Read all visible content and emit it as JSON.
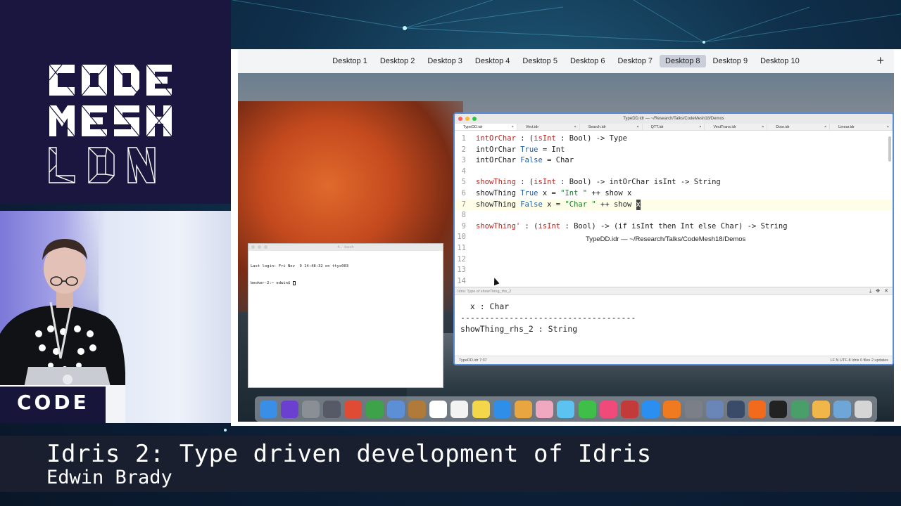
{
  "caption": {
    "title": "Idris 2: Type driven development of Idris",
    "author": "Edwin Brady"
  },
  "logo": {
    "lines": [
      "CODE",
      "MESH",
      "LDN"
    ]
  },
  "podium_sign": "CODE",
  "spaces": {
    "items": [
      "Desktop 1",
      "Desktop 2",
      "Desktop 3",
      "Desktop 4",
      "Desktop 5",
      "Desktop 6",
      "Desktop 7",
      "Desktop 8",
      "Desktop 9",
      "Desktop 10"
    ],
    "active": "Desktop 8",
    "add_label": "+"
  },
  "editor": {
    "window_title": "TypeDD.idr — ~/Research/Talks/CodeMesh18/Demos",
    "tabs": [
      "TypeDD.idr",
      "Vect.idr",
      "Search.idr",
      "QTT.idr",
      "VectTrans.idr",
      "Door.idr",
      "Linear.idr"
    ],
    "tooltip": "TypeDD.idr — ~/Research/Talks/CodeMesh18/Demos",
    "line_numbers": [
      "1",
      "2",
      "3",
      "4",
      "5",
      "6",
      "7",
      "8",
      "9",
      "10",
      "11",
      "12",
      "13",
      "14"
    ],
    "code": {
      "l1": [
        [
          "intOrChar",
          "fn"
        ],
        [
          " : (",
          "plain"
        ],
        [
          "isInt",
          "fn"
        ],
        [
          " : Bool) -> Type",
          "plain"
        ]
      ],
      "l2": [
        [
          "intOrChar ",
          "plain"
        ],
        [
          "True",
          "ty"
        ],
        [
          " = Int",
          "plain"
        ]
      ],
      "l3": [
        [
          "intOrChar ",
          "plain"
        ],
        [
          "False",
          "ty"
        ],
        [
          " = Char",
          "plain"
        ]
      ],
      "l5": [
        [
          "showThing",
          "fn"
        ],
        [
          " : (",
          "plain"
        ],
        [
          "isInt",
          "fn"
        ],
        [
          " : Bool) -> intOrChar isInt -> String",
          "plain"
        ]
      ],
      "l6": [
        [
          "showThing ",
          "plain"
        ],
        [
          "True",
          "ty"
        ],
        [
          " x = ",
          "plain"
        ],
        [
          "\"Int \"",
          "str"
        ],
        [
          " ++ show x",
          "plain"
        ]
      ],
      "l7": [
        [
          "showThing ",
          "plain"
        ],
        [
          "False",
          "ty"
        ],
        [
          " x = ",
          "plain"
        ],
        [
          "\"Char \"",
          "str"
        ],
        [
          " ++ show ",
          "plain"
        ]
      ],
      "l7_cursor": "x",
      "l9": [
        [
          "showThing'",
          "fn"
        ],
        [
          " : (",
          "plain"
        ],
        [
          "isInt",
          "fn"
        ],
        [
          " : Bool) -> (if isInt then Int else Char) -> String",
          "plain"
        ]
      ]
    },
    "pane_header": "Idris: Type of showThing_rhs_2",
    "pane_lines": [
      "  x : Char",
      "------------------------------------",
      "showThing_rhs_2 : String"
    ],
    "status_left": "TypeDD.idr   7:37",
    "status_right": "LF   N   UTF-8   Idris   0 files   2 updates"
  },
  "terminal": {
    "title": "4. bash",
    "lines": [
      "Last login: Fri Nov  9 14:48:32 on ttys003",
      "beoker-2:~ edwin$ "
    ]
  },
  "dock": {
    "icons": [
      "finder-icon",
      "siri-icon",
      "launchpad-icon",
      "mission-control-icon",
      "chrome-icon",
      "vim-icon",
      "preview-icon",
      "contacts-icon",
      "calendar-icon",
      "notes-icon",
      "stickies-icon",
      "safari-icon",
      "keynote-icon",
      "photos-icon",
      "messages-icon",
      "facetime-icon",
      "itunes-icon",
      "photobooth-icon",
      "appstore-icon",
      "books-icon",
      "system-prefs-icon",
      "utility-icon",
      "steam-icon",
      "firefox-icon",
      "terminal-icon",
      "atom-icon",
      "pages-icon",
      "downloads-icon",
      "trash-icon"
    ],
    "colors": [
      "#3a8ee6",
      "#6b3fd0",
      "#8a8f96",
      "#555a66",
      "#e04b36",
      "#3ea24a",
      "#5c8fd6",
      "#b07a3a",
      "#ffffff",
      "#f2f2f2",
      "#f3d64a",
      "#2f8fe8",
      "#e9a640",
      "#f0a7c0",
      "#5cc2f0",
      "#3fbf4a",
      "#f04a7a",
      "#c23a3a",
      "#2a8ff0",
      "#f07a1f",
      "#7b7f88",
      "#6a86b8",
      "#3a4b6a",
      "#f26b1d",
      "#222222",
      "#4a9e6a",
      "#f0b64a",
      "#6fa6d8",
      "#d5d5d5"
    ]
  },
  "colors": {
    "accent": "#5a8fd8",
    "caption_bg": "#1c2030",
    "logo_bg": "#1a1640"
  }
}
